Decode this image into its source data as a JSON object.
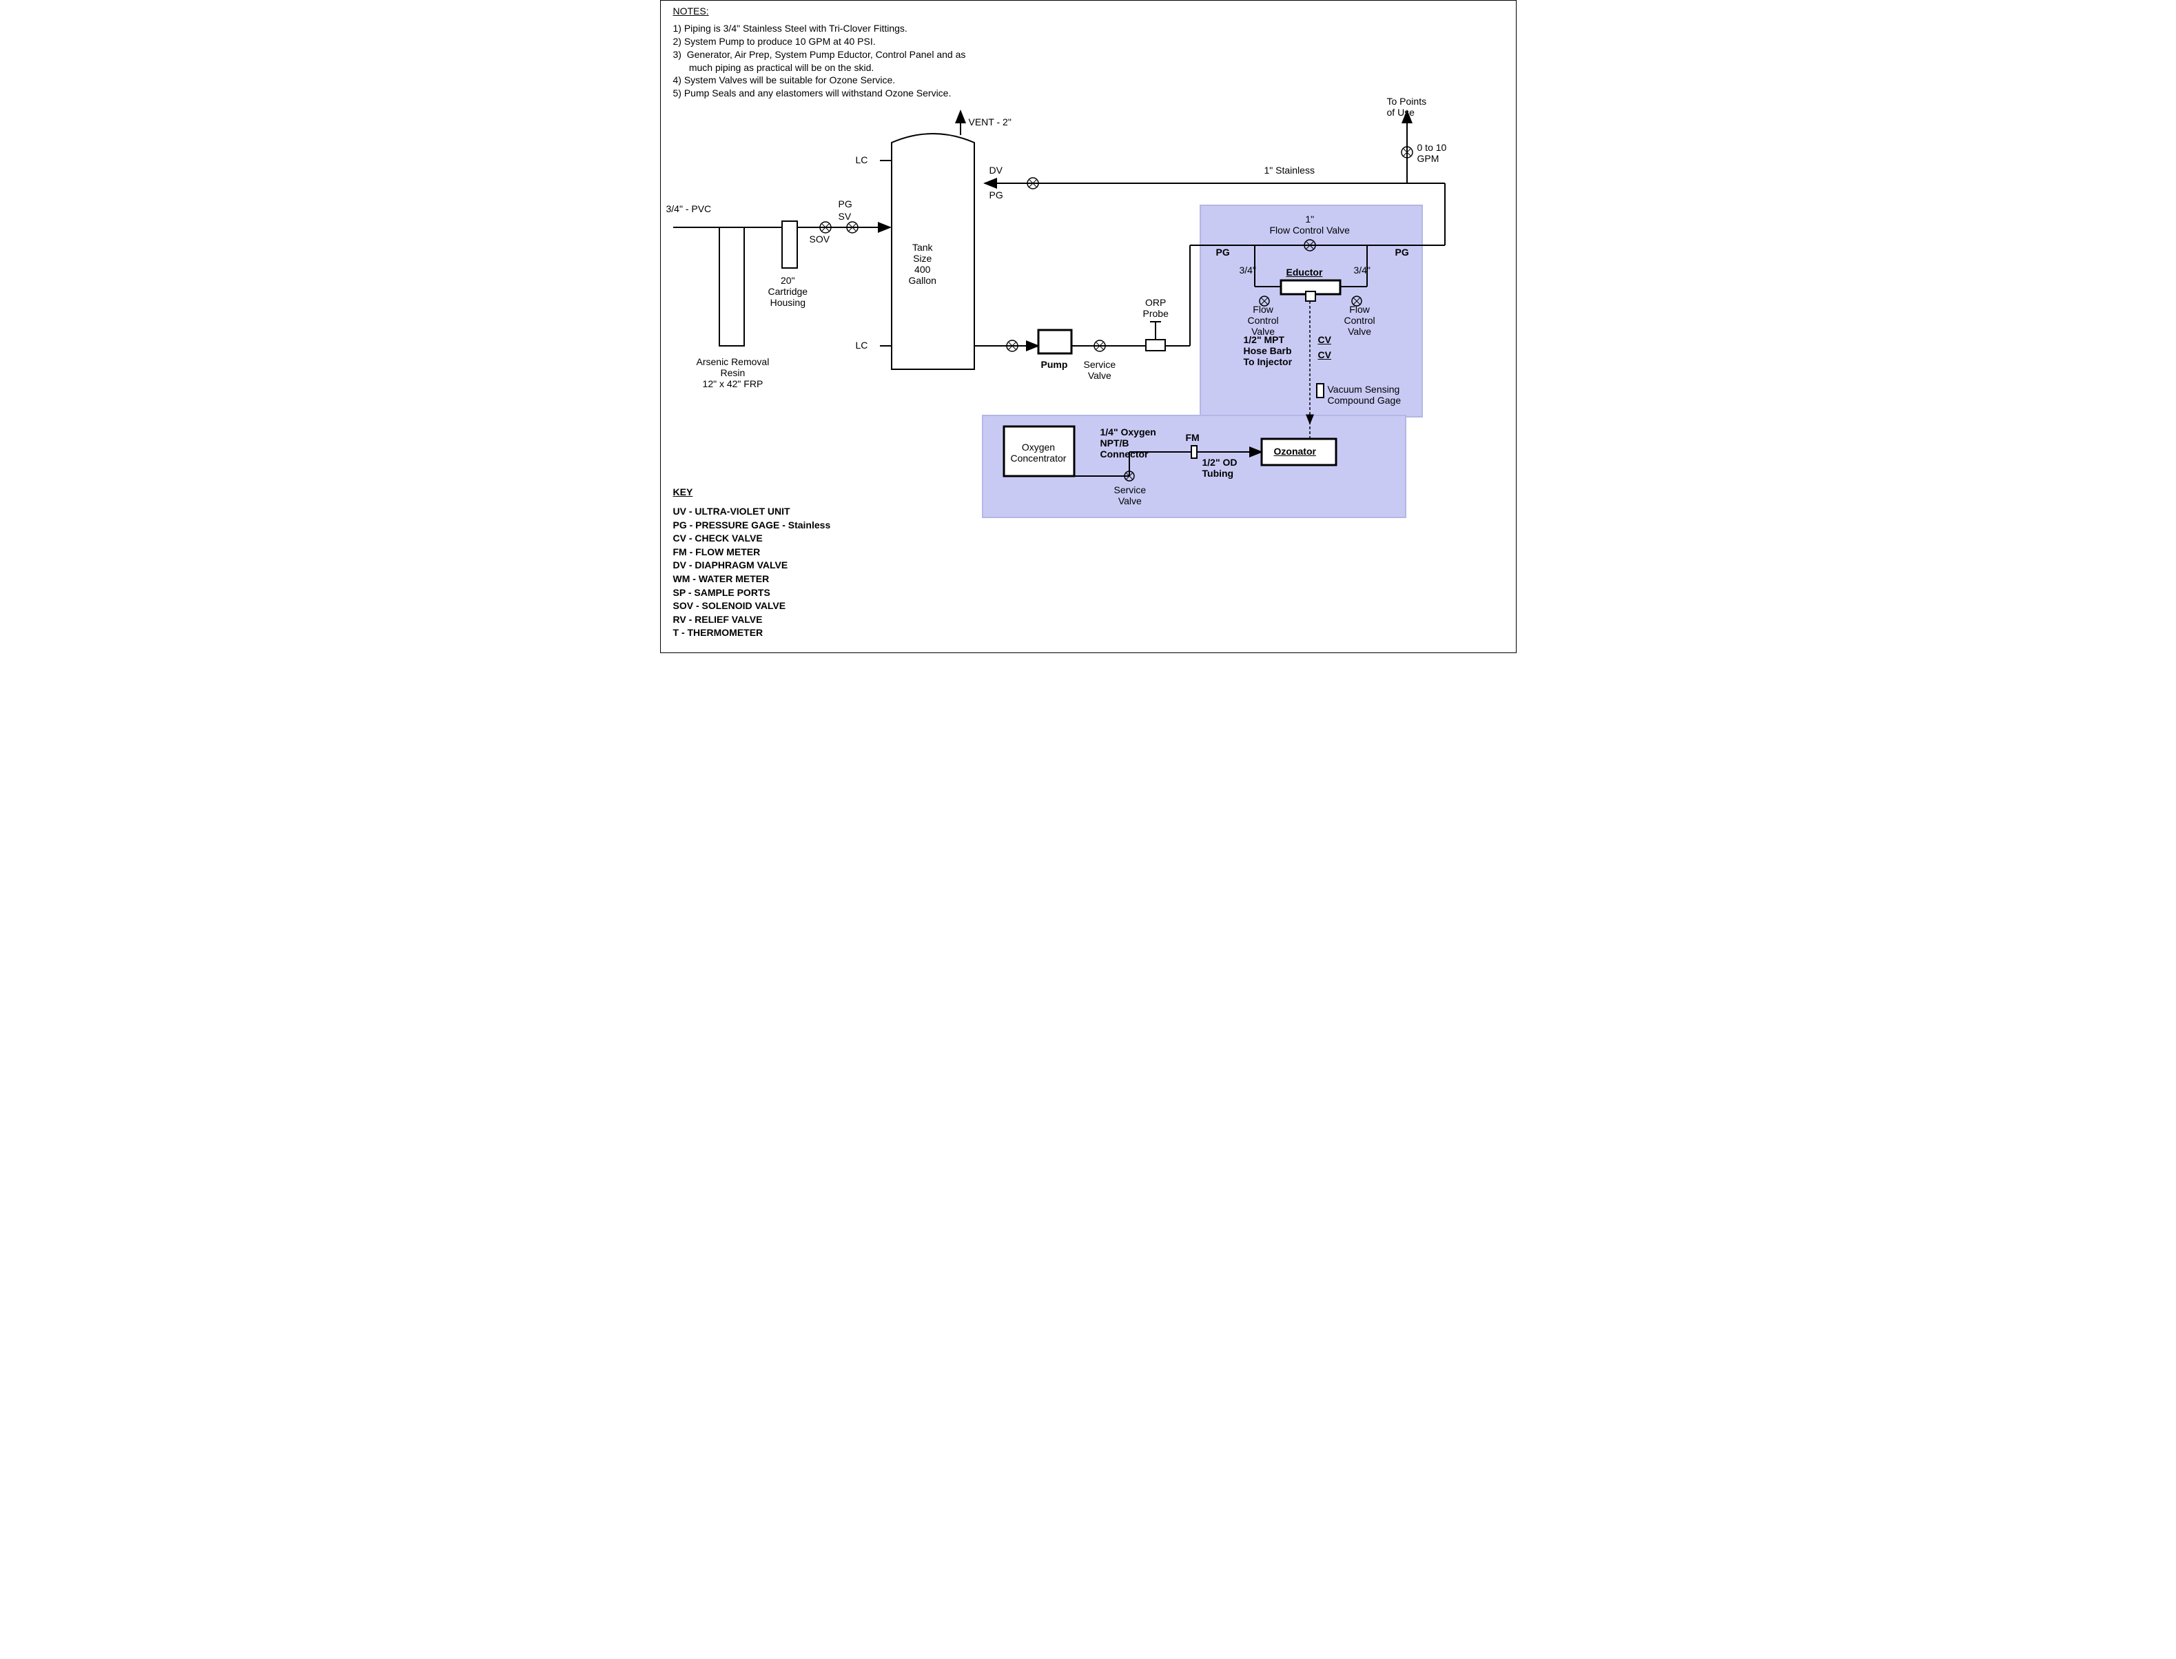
{
  "notes": {
    "title": "NOTES:",
    "items": [
      "1)  Piping is 3/4\" Stainless Steel with Tri-Clover Fittings.",
      "2)  System Pump to produce 10 GPM at 40 PSI.",
      "3)  Generator, Air Prep, System Pump Eductor, Control Panel and as\n      much piping as practical will be on the skid.",
      "4)  System Valves will be suitable for Ozone Service.",
      "5)  Pump Seals and any elastomers will withstand Ozone Service."
    ]
  },
  "key": {
    "title": "KEY",
    "items": [
      "UV - ULTRA-VIOLET UNIT",
      "PG -  PRESSURE GAGE  -  Stainless",
      "CV  -  CHECK VALVE",
      "FM -  FLOW METER",
      "DV  -  DIAPHRAGM VALVE",
      "WM -  WATER METER",
      "SP  -  SAMPLE PORTS",
      "SOV -  SOLENOID VALVE",
      "RV  -  RELIEF VALVE",
      "T  -  THERMOMETER"
    ]
  },
  "labels": {
    "vent": "VENT - 2\"",
    "lc1": "LC",
    "lc2": "LC",
    "dv": "DV",
    "pg_inlet": "PG",
    "pg_top": "PG",
    "sv": "SV",
    "sov": "SOV",
    "pvc": "3/4\" - PVC",
    "tank": "Tank\nSize\n400\nGallon",
    "cartridge": "20\"\nCartridge\nHousing",
    "arsenic": "Arsenic Removal\nResin\n12\" x 42\" FRP",
    "pump": "Pump",
    "service_valve": "Service\nValve",
    "orp": "ORP\nProbe",
    "stainless": "1\" Stainless",
    "points": "To Points\nof Use",
    "gpm": "0 to 10\nGPM",
    "fcv_main": "1\"\nFlow Control Valve",
    "pg_left": "PG",
    "pg_right": "PG",
    "three4_l": "3/4\"",
    "three4_r": "3/4\"",
    "eductor": "Eductor",
    "fcv_l": "Flow\nControl\nValve",
    "fcv_r": "Flow\nControl\nValve",
    "mpt": "1/2\" MPT\nHose Barb\nTo Injector",
    "cv1": "CV",
    "cv2": "CV",
    "vac": "Vacuum Sensing\nCompound Gage",
    "oxy_conc": "Oxygen\nConcentrator",
    "oxy_conn": "1/4\" Oxygen\nNPT/B\nConnector",
    "fm": "FM",
    "tubing": "1/2\" OD\nTubing",
    "ozonator": "Ozonator",
    "service_valve2": "Service\nValve"
  }
}
